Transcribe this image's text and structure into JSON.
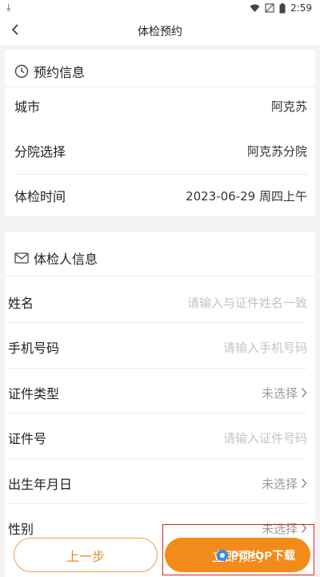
{
  "status_bar": {
    "time": "2:59",
    "icons": [
      "download-icon",
      "wifi-icon",
      "signal-off-icon",
      "battery-icon"
    ]
  },
  "nav": {
    "title": "体检预约",
    "back_icon": "chevron-left-icon"
  },
  "booking_info": {
    "header": "预约信息",
    "icon": "clock-icon",
    "rows": [
      {
        "label": "城市",
        "value": "阿克苏"
      },
      {
        "label": "分院选择",
        "value": "阿克苏分院"
      },
      {
        "label": "体检时间",
        "value": "2023-06-29 周四上午"
      }
    ]
  },
  "person_info": {
    "header": "体检人信息",
    "icon": "mail-icon",
    "rows": [
      {
        "label": "姓名",
        "placeholder": "请输入与证件姓名一致"
      },
      {
        "label": "手机号码",
        "placeholder": "请输入手机号码"
      },
      {
        "label": "证件类型",
        "value": "未选择"
      },
      {
        "label": "证件号",
        "placeholder": "请输入证件号码"
      },
      {
        "label": "出生年月日",
        "value": "未选择"
      },
      {
        "label": "性别",
        "value": "未选择"
      }
    ]
  },
  "footer": {
    "prev_label": "上一步",
    "submit_label": "立即预约"
  },
  "watermark": {
    "text": "PCPOP下载"
  },
  "colors": {
    "accent": "#f38b1b",
    "highlight": "#e02020"
  }
}
